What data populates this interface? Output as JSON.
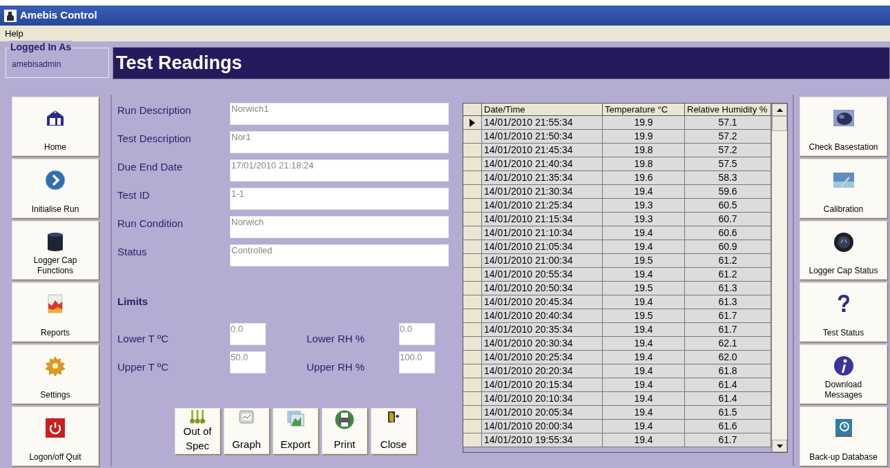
{
  "window": {
    "title": "Amebis Control"
  },
  "menu": [
    "Help"
  ],
  "logged_in": {
    "legend": "Logged In As",
    "user": "amebisadmin"
  },
  "header": {
    "title": "Test Readings"
  },
  "nav_left": [
    {
      "label": "Home"
    },
    {
      "label": "Initialise Run"
    },
    {
      "label": "Logger Cap Functions"
    },
    {
      "label": "Reports"
    },
    {
      "label": "Settings"
    },
    {
      "label": "Logon/off Quit"
    }
  ],
  "form": {
    "fields": [
      {
        "label": "Run Description",
        "value": "Norwich1"
      },
      {
        "label": "Test Description",
        "value": "Nor1"
      },
      {
        "label": "Due End Date",
        "value": "17/01/2010 21:18:24"
      },
      {
        "label": "Test ID",
        "value": "1-1"
      },
      {
        "label": "Run Condition",
        "value": "Norwich"
      },
      {
        "label": "Status",
        "value": "Controlled"
      }
    ]
  },
  "limits": {
    "heading": "Limits",
    "rows": [
      [
        {
          "label": "Lower T ºC",
          "value": "0.0"
        },
        {
          "label": "Lower RH %",
          "value": "0.0"
        }
      ],
      [
        {
          "label": "Upper T ºC",
          "value": "50.0"
        },
        {
          "label": "Upper RH %",
          "value": "100.0"
        }
      ]
    ]
  },
  "actions": [
    {
      "label": "Out of Spec"
    },
    {
      "label": "Graph"
    },
    {
      "label": "Export"
    },
    {
      "label": "Print"
    },
    {
      "label": "Close"
    }
  ],
  "table": {
    "columns": [
      "Date/Time",
      "Temperature °C",
      "Relative Humidity %"
    ],
    "rows": [
      {
        "selected": true,
        "cells": [
          "14/01/2010 21:55:34",
          "19.9",
          "57.1"
        ]
      },
      {
        "selected": false,
        "cells": [
          "14/01/2010 21:50:34",
          "19.9",
          "57.2"
        ]
      },
      {
        "selected": false,
        "cells": [
          "14/01/2010 21:45:34",
          "19.8",
          "57.2"
        ]
      },
      {
        "selected": false,
        "cells": [
          "14/01/2010 21:40:34",
          "19.8",
          "57.5"
        ]
      },
      {
        "selected": false,
        "cells": [
          "14/01/2010 21:35:34",
          "19.6",
          "58.3"
        ]
      },
      {
        "selected": false,
        "cells": [
          "14/01/2010 21:30:34",
          "19.4",
          "59.6"
        ]
      },
      {
        "selected": false,
        "cells": [
          "14/01/2010 21:25:34",
          "19.3",
          "60.5"
        ]
      },
      {
        "selected": false,
        "cells": [
          "14/01/2010 21:15:34",
          "19.3",
          "60.7"
        ]
      },
      {
        "selected": false,
        "cells": [
          "14/01/2010 21:10:34",
          "19.4",
          "60.6"
        ]
      },
      {
        "selected": false,
        "cells": [
          "14/01/2010 21:05:34",
          "19.4",
          "60.9"
        ]
      },
      {
        "selected": false,
        "cells": [
          "14/01/2010 21:00:34",
          "19.5",
          "61.2"
        ]
      },
      {
        "selected": false,
        "cells": [
          "14/01/2010 20:55:34",
          "19.4",
          "61.2"
        ]
      },
      {
        "selected": false,
        "cells": [
          "14/01/2010 20:50:34",
          "19.5",
          "61.3"
        ]
      },
      {
        "selected": false,
        "cells": [
          "14/01/2010 20:45:34",
          "19.4",
          "61.3"
        ]
      },
      {
        "selected": false,
        "cells": [
          "14/01/2010 20:40:34",
          "19.5",
          "61.7"
        ]
      },
      {
        "selected": false,
        "cells": [
          "14/01/2010 20:35:34",
          "19.4",
          "61.7"
        ]
      },
      {
        "selected": false,
        "cells": [
          "14/01/2010 20:30:34",
          "19.4",
          "62.1"
        ]
      },
      {
        "selected": false,
        "cells": [
          "14/01/2010 20:25:34",
          "19.4",
          "62.0"
        ]
      },
      {
        "selected": false,
        "cells": [
          "14/01/2010 20:20:34",
          "19.4",
          "61.8"
        ]
      },
      {
        "selected": false,
        "cells": [
          "14/01/2010 20:15:34",
          "19.4",
          "61.4"
        ]
      },
      {
        "selected": false,
        "cells": [
          "14/01/2010 20:10:34",
          "19.4",
          "61.4"
        ]
      },
      {
        "selected": false,
        "cells": [
          "14/01/2010 20:05:34",
          "19.4",
          "61.5"
        ]
      },
      {
        "selected": false,
        "cells": [
          "14/01/2010 20:00:34",
          "19.4",
          "61.6"
        ]
      },
      {
        "selected": false,
        "cells": [
          "14/01/2010 19:55:34",
          "19.4",
          "61.7"
        ]
      }
    ]
  },
  "nav_right": [
    {
      "label": "Check Basestation"
    },
    {
      "label": "Calibration"
    },
    {
      "label": "Logger Cap Status"
    },
    {
      "label": "Test Status"
    },
    {
      "label": "Download Messages"
    },
    {
      "label": "Back-up Database"
    }
  ]
}
